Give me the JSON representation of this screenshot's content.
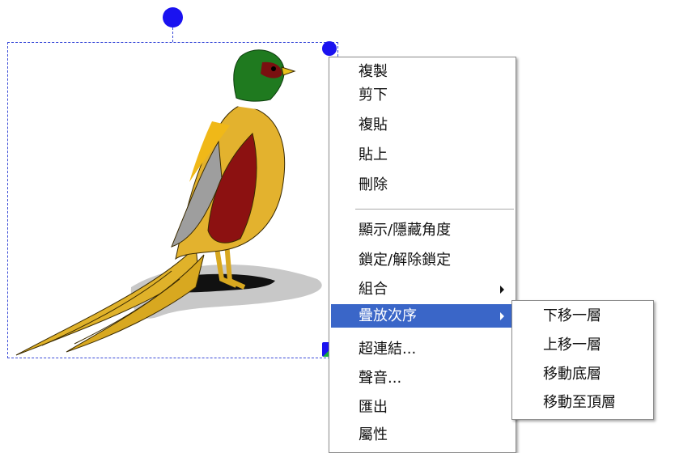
{
  "context_menu": {
    "items": [
      {
        "label": "複製"
      },
      {
        "label": "剪下"
      },
      {
        "label": "複貼"
      },
      {
        "label": "貼上"
      },
      {
        "label": "刪除"
      },
      {
        "label": "顯示/隱藏角度"
      },
      {
        "label": "鎖定/解除鎖定"
      },
      {
        "label": "組合",
        "has_submenu": true
      },
      {
        "label": "疊放次序",
        "has_submenu": true,
        "highlighted": true
      },
      {
        "label": "超連結..."
      },
      {
        "label": "聲音..."
      },
      {
        "label": "匯出"
      },
      {
        "label": "屬性"
      }
    ]
  },
  "submenu": {
    "items": [
      {
        "label": "下移一層"
      },
      {
        "label": "上移一層"
      },
      {
        "label": "移動底層"
      },
      {
        "label": "移動至頂層"
      }
    ]
  },
  "colors": {
    "selection": "#3a4bd8",
    "handle": "#1a12f0",
    "menu_highlight": "#3a66c8"
  },
  "image": {
    "subject": "pheasant-illustration"
  }
}
